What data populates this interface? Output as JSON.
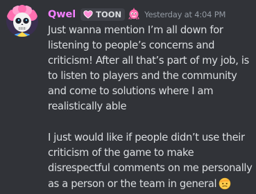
{
  "message": {
    "author": {
      "name": "Qwel",
      "name_color": "#f47fff",
      "avatar_icon": "skull-clown-avatar"
    },
    "badge": {
      "icon": "heart-badge-icon",
      "label": "TOON"
    },
    "role_icon": "pink-creature-role-icon",
    "timestamp": "Yesterday at 4:04 PM",
    "paragraphs": [
      "Just wanna mention I’m all down for listening to people’s concerns and criticism! After all that’s part of my job, is to listen to players and the community and come to solutions where I am realistically able",
      "I just would like if people didn’t use their criticism of the game to make disrespectful comments on me personally as a person or the team in general"
    ],
    "trailing_emoji": "saluting-face-emoji"
  }
}
